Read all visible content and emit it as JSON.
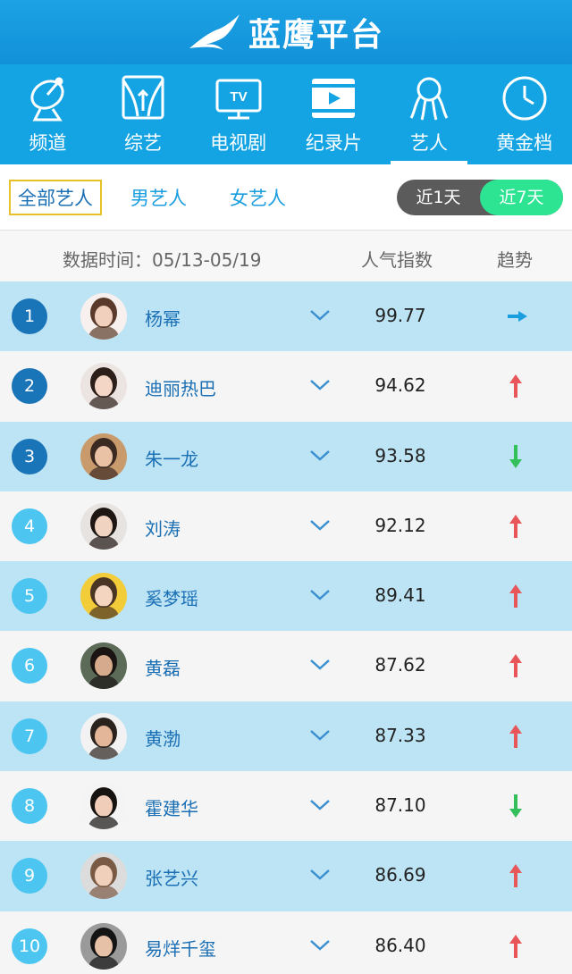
{
  "app": {
    "title": "蓝鹰平台"
  },
  "nav": [
    {
      "label": "频道",
      "icon": "satellite-dish-icon"
    },
    {
      "label": "综艺",
      "icon": "stage-curtain-icon"
    },
    {
      "label": "电视剧",
      "icon": "tv-icon",
      "icon_text": "TV"
    },
    {
      "label": "纪录片",
      "icon": "film-play-icon"
    },
    {
      "label": "艺人",
      "icon": "artist-icon",
      "active": true
    },
    {
      "label": "黄金档",
      "icon": "clock-icon"
    }
  ],
  "filters": {
    "all": "全部艺人",
    "male": "男艺人",
    "female": "女艺人",
    "day1": "近1天",
    "day7": "近7天",
    "selected_period": "近7天"
  },
  "table_header": {
    "date": "数据时间：05/13-05/19",
    "score": "人气指数",
    "trend": "趋势"
  },
  "colors": {
    "accent": "#14a4e3",
    "up": "#e8565a",
    "down": "#33bf5a",
    "flat": "#1a9ee0",
    "toggle_on": "#2de493"
  },
  "rows": [
    {
      "rank": "1",
      "name": "杨幂",
      "score": "99.77",
      "trend": "flat"
    },
    {
      "rank": "2",
      "name": "迪丽热巴",
      "score": "94.62",
      "trend": "up"
    },
    {
      "rank": "3",
      "name": "朱一龙",
      "score": "93.58",
      "trend": "down"
    },
    {
      "rank": "4",
      "name": "刘涛",
      "score": "92.12",
      "trend": "up"
    },
    {
      "rank": "5",
      "name": "奚梦瑶",
      "score": "89.41",
      "trend": "up"
    },
    {
      "rank": "6",
      "name": "黄磊",
      "score": "87.62",
      "trend": "up"
    },
    {
      "rank": "7",
      "name": "黄渤",
      "score": "87.33",
      "trend": "up"
    },
    {
      "rank": "8",
      "name": "霍建华",
      "score": "87.10",
      "trend": "down"
    },
    {
      "rank": "9",
      "name": "张艺兴",
      "score": "86.69",
      "trend": "up"
    },
    {
      "rank": "10",
      "name": "易烊千玺",
      "score": "86.40",
      "trend": "up"
    }
  ]
}
